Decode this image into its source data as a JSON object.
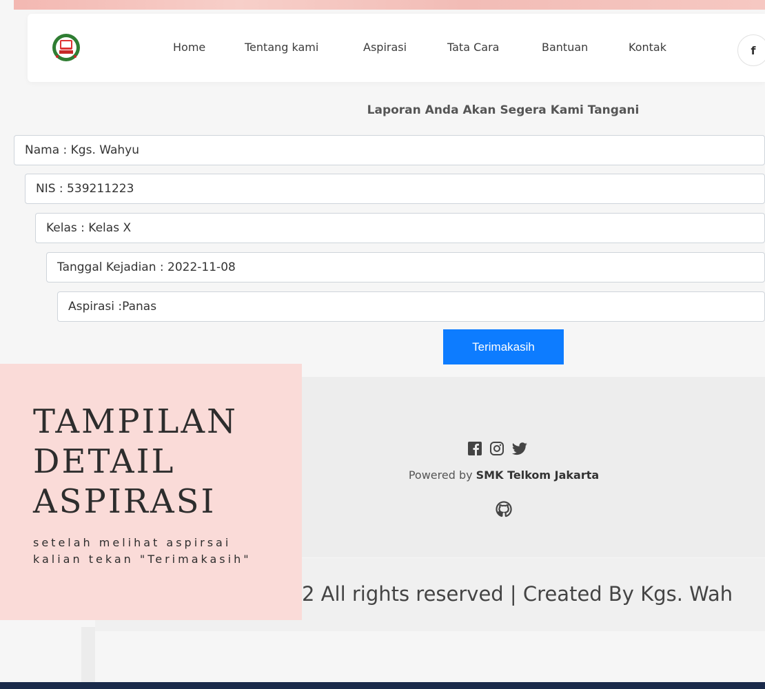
{
  "nav": {
    "logo_alt": "school-emblem",
    "items": [
      "Home",
      "Tentang kami",
      "Aspirasi",
      "Tata Cara",
      "Bantuan",
      "Kontak"
    ],
    "social_fb": "f"
  },
  "main": {
    "heading": "Laporan Anda Akan Segera Kami Tangani",
    "fields": [
      "Nama : Kgs. Wahyu",
      "NIS : 539211223",
      "Kelas : Kelas X",
      "Tanggal Kejadian : 2022-11-08",
      "Aspirasi :Panas"
    ],
    "button_label": "Terimakasih",
    "button_color": "#0d7cff"
  },
  "footer": {
    "icons": [
      "facebook-icon",
      "instagram-icon",
      "twitter-icon",
      "github-icon"
    ],
    "powered_prefix": "Powered by ",
    "powered_brand": "SMK Telkom Jakarta",
    "copyright": "2 All rights reserved | Created By Kgs. Wah"
  },
  "overlay": {
    "title": "TAMPILAN DETAIL ASPIRASI",
    "description": "setelah melihat aspirsai kalian tekan \"Terimakasih\"",
    "background": "#fadbd8"
  }
}
